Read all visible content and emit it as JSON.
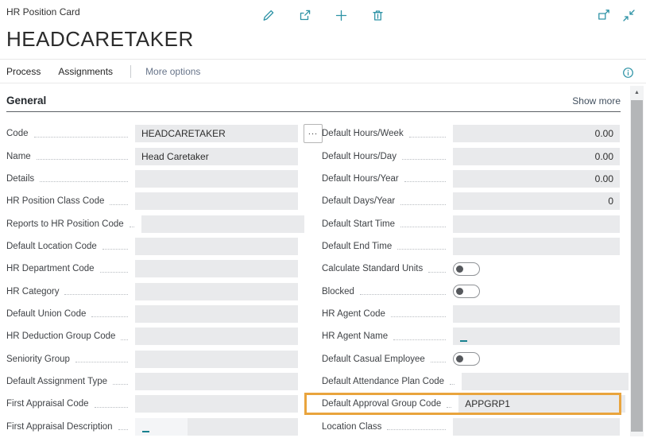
{
  "header": {
    "caption": "HR Position Card",
    "title": "HEADCARETAKER"
  },
  "toolbar": {
    "icons": [
      "edit-pencil-icon",
      "share-icon",
      "add-new-icon",
      "delete-trash-icon"
    ],
    "window_icons": [
      "popout-icon",
      "collapse-icon"
    ]
  },
  "menubar": {
    "items": [
      "Process",
      "Assignments"
    ],
    "more_options": "More options",
    "info_icon": "info-icon"
  },
  "section": {
    "title": "General",
    "show_more_label": "Show more"
  },
  "fields": {
    "left": [
      {
        "name": "code",
        "label": "Code",
        "value": "HEADCARETAKER",
        "assist": true
      },
      {
        "name": "name",
        "label": "Name",
        "value": "Head Caretaker"
      },
      {
        "name": "details",
        "label": "Details",
        "value": ""
      },
      {
        "name": "hr-position-class-code",
        "label": "HR Position Class Code",
        "value": ""
      },
      {
        "name": "reports-to-hr-position-code",
        "label": "Reports to HR Position Code",
        "value": ""
      },
      {
        "name": "default-location-code",
        "label": "Default Location Code",
        "value": ""
      },
      {
        "name": "hr-department-code",
        "label": "HR Department Code",
        "value": ""
      },
      {
        "name": "hr-category",
        "label": "HR Category",
        "value": ""
      },
      {
        "name": "default-union-code",
        "label": "Default Union Code",
        "value": ""
      },
      {
        "name": "hr-deduction-group-code",
        "label": "HR Deduction Group Code",
        "value": ""
      },
      {
        "name": "seniority-group",
        "label": "Seniority Group",
        "value": ""
      },
      {
        "name": "default-assignment-type",
        "label": "Default Assignment Type",
        "value": ""
      },
      {
        "name": "first-appraisal-code",
        "label": "First Appraisal Code",
        "value": ""
      },
      {
        "name": "first-appraisal-description",
        "label": "First Appraisal Description",
        "value": "",
        "caret": true,
        "tone": "split"
      }
    ],
    "right": [
      {
        "name": "default-hours-week",
        "label": "Default Hours/Week",
        "value": "0.00",
        "align": "right"
      },
      {
        "name": "default-hours-day",
        "label": "Default Hours/Day",
        "value": "0.00",
        "align": "right"
      },
      {
        "name": "default-hours-year",
        "label": "Default Hours/Year",
        "value": "0.00",
        "align": "right"
      },
      {
        "name": "default-days-year",
        "label": "Default Days/Year",
        "value": "0",
        "align": "right"
      },
      {
        "name": "default-start-time",
        "label": "Default Start Time",
        "value": ""
      },
      {
        "name": "default-end-time",
        "label": "Default End Time",
        "value": ""
      },
      {
        "name": "calculate-standard-units",
        "label": "Calculate Standard Units",
        "control": "toggle",
        "state": "off"
      },
      {
        "name": "blocked",
        "label": "Blocked",
        "control": "toggle",
        "state": "off"
      },
      {
        "name": "hr-agent-code",
        "label": "HR Agent Code",
        "value": ""
      },
      {
        "name": "hr-agent-name",
        "label": "HR Agent Name",
        "value": "",
        "caret": true
      },
      {
        "name": "default-casual-employee",
        "label": "Default Casual Employee",
        "control": "toggle",
        "state": "off"
      },
      {
        "name": "default-attendance-plan-code",
        "label": "Default Attendance Plan Code",
        "value": ""
      },
      {
        "name": "default-approval-group-code",
        "label": "Default Approval Group Code",
        "value": "APPGRP1",
        "highlight": true
      },
      {
        "name": "location-class",
        "label": "Location Class",
        "value": ""
      }
    ]
  },
  "colors": {
    "accent_teal": "#2e93a6",
    "highlight_orange": "#e9a43d",
    "input_bg": "#e9eaec",
    "caret_teal": "#17818f"
  }
}
